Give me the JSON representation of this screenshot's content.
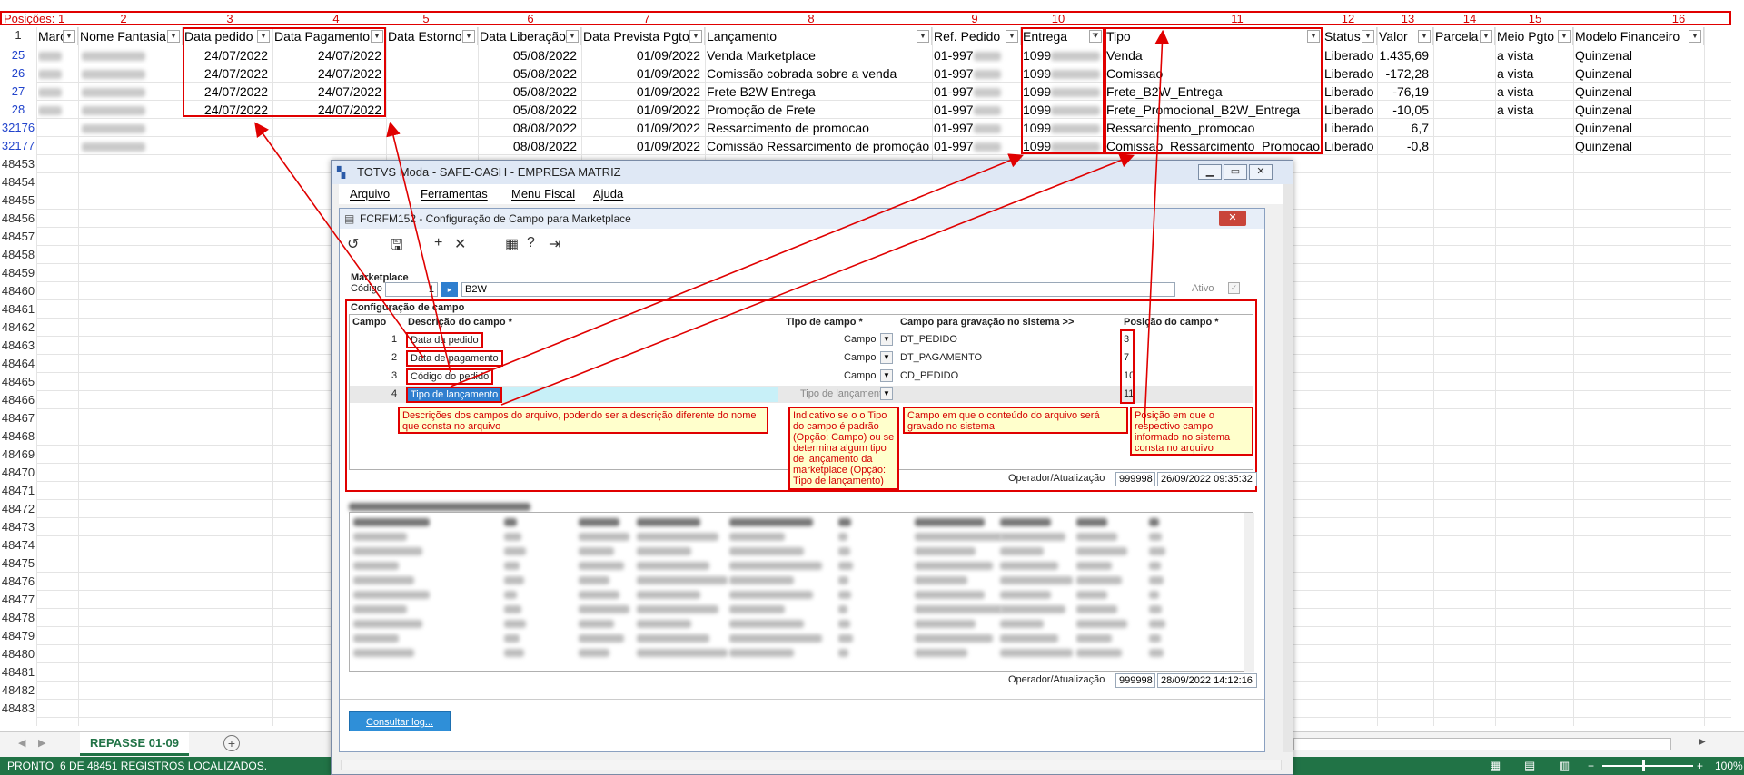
{
  "positions_row": {
    "label": "Posições: 1",
    "numbers": [
      "2",
      "3",
      "4",
      "5",
      "6",
      "7",
      "8",
      "9",
      "10",
      "11",
      "12",
      "13",
      "14",
      "15",
      "16"
    ]
  },
  "columns": [
    "Marc",
    "Nome Fantasia",
    "Data pedido",
    "Data Pagamento",
    "Data Estorno",
    "Data Liberação",
    "Data Prevista Pgto",
    "Lançamento",
    "Ref. Pedido",
    "Entrega",
    "Tipo",
    "Status",
    "Valor",
    "Parcela",
    "Meio Pgto",
    "Modelo Financeiro"
  ],
  "header_row_number": "1",
  "rows": [
    {
      "num": "25",
      "data_pedido": "24/07/2022",
      "data_pagamento": "24/07/2022",
      "data_liberacao": "05/08/2022",
      "data_prevista": "01/09/2022",
      "lancamento": "Venda Marketplace",
      "ref": "01-997",
      "entrega": "1099",
      "tipo": "Venda",
      "status": "Liberado",
      "valor": "1.435,69",
      "meio": "a vista",
      "modelo": "Quinzenal"
    },
    {
      "num": "26",
      "data_pedido": "24/07/2022",
      "data_pagamento": "24/07/2022",
      "data_liberacao": "05/08/2022",
      "data_prevista": "01/09/2022",
      "lancamento": "Comissão cobrada sobre a venda",
      "ref": "01-997",
      "entrega": "1099",
      "tipo": "Comissao",
      "status": "Liberado",
      "valor": "-172,28",
      "meio": "a vista",
      "modelo": "Quinzenal"
    },
    {
      "num": "27",
      "data_pedido": "24/07/2022",
      "data_pagamento": "24/07/2022",
      "data_liberacao": "05/08/2022",
      "data_prevista": "01/09/2022",
      "lancamento": "Frete B2W Entrega",
      "ref": "01-997",
      "entrega": "1099",
      "tipo": "Frete_B2W_Entrega",
      "status": "Liberado",
      "valor": "-76,19",
      "meio": "a vista",
      "modelo": "Quinzenal"
    },
    {
      "num": "28",
      "data_pedido": "24/07/2022",
      "data_pagamento": "24/07/2022",
      "data_liberacao": "05/08/2022",
      "data_prevista": "01/09/2022",
      "lancamento": "Promoção de Frete",
      "ref": "01-997",
      "entrega": "1099",
      "tipo": "Frete_Promocional_B2W_Entrega",
      "status": "Liberado",
      "valor": "-10,05",
      "meio": "a vista",
      "modelo": "Quinzenal"
    },
    {
      "num": "32176",
      "data_pedido": "",
      "data_pagamento": "",
      "data_liberacao": "08/08/2022",
      "data_prevista": "01/09/2022",
      "lancamento": "Ressarcimento de promocao",
      "ref": "01-997",
      "entrega": "1099",
      "tipo": "Ressarcimento_promocao",
      "status": "Liberado",
      "valor": "6,7",
      "meio": "",
      "modelo": "Quinzenal"
    },
    {
      "num": "32177",
      "data_pedido": "",
      "data_pagamento": "",
      "data_liberacao": "08/08/2022",
      "data_prevista": "01/09/2022",
      "lancamento": "Comissão Ressarcimento de promoção",
      "ref": "01-997",
      "entrega": "1099",
      "tipo": "Comissao_Ressarcimento_Promocao",
      "status": "Liberado",
      "valor": "-0,8",
      "meio": "",
      "modelo": "Quinzenal"
    }
  ],
  "empty_row_numbers": [
    "48453",
    "48454",
    "48455",
    "48456",
    "48457",
    "48458",
    "48459",
    "48460",
    "48461",
    "48462",
    "48463",
    "48464",
    "48465",
    "48466",
    "48467",
    "48468",
    "48469",
    "48470",
    "48471",
    "48472",
    "48473",
    "48474",
    "48475",
    "48476",
    "48477",
    "48478",
    "48479",
    "48480",
    "48481",
    "48482",
    "48483"
  ],
  "sheet_tab": "REPASSE 01-09",
  "status_bar": {
    "mode": "PRONTO",
    "records": "6 DE 48451 REGISTROS LOCALIZADOS.",
    "zoom": "100%"
  },
  "window": {
    "title": "TOTVS Moda - SAFE-CASH - EMPRESA MATRIZ",
    "menu": [
      "Arquivo",
      "Ferramentas",
      "Menu Fiscal",
      "Ajuda"
    ],
    "inner_title": "FCRFM152 - Configuração de Campo para Marketplace",
    "marketplace_section": "Marketplace",
    "codigo_label": "Código",
    "codigo_value": "1",
    "marketplace_name": "B2W",
    "ativo_label": "Ativo",
    "config_section": "Configuração de campo",
    "grid_headers": [
      "Campo",
      "Descrição do campo *",
      "Tipo de campo *",
      "Campo para gravação no sistema >>",
      "Posição do campo *"
    ],
    "grid_rows": [
      {
        "campo": "1",
        "descricao": "Data da pedido",
        "tipo": "Campo",
        "gravacao": "DT_PEDIDO",
        "posicao": "3"
      },
      {
        "campo": "2",
        "descricao": "Data de pagamento",
        "tipo": "Campo",
        "gravacao": "DT_PAGAMENTO",
        "posicao": "7"
      },
      {
        "campo": "3",
        "descricao": "Código do pedido",
        "tipo": "Campo",
        "gravacao": "CD_PEDIDO",
        "posicao": "10"
      },
      {
        "campo": "4",
        "descricao": "Tipo de lançamento",
        "tipo": "Tipo de lançamento",
        "gravacao": "",
        "posicao": "11"
      }
    ],
    "notes": {
      "descricao": "Descrições dos campos do arquivo, podendo ser a descrição diferente do nome que consta no arquivo",
      "tipo": "Indicativo se o o Tipo do campo é padrão (Opção: Campo) ou se determina algum tipo de lançamento da marketplace (Opção: Tipo de lançamento)",
      "gravacao": "Campo em que o conteúdo do arquivo será gravado no sistema",
      "posicao": "Posição em que o respectivo campo informado no sistema consta no arquivo"
    },
    "operador_label": "Operador/Atualização",
    "operador1": "999998",
    "data1": "26/09/2022 09:35:32",
    "operador2": "999998",
    "data2": "28/09/2022 14:12:16",
    "consultar_log": "Consultar log..."
  },
  "colors": {
    "excel_green": "#217346",
    "annotation_red": "#e00000",
    "note_bg": "#ffffcc"
  }
}
